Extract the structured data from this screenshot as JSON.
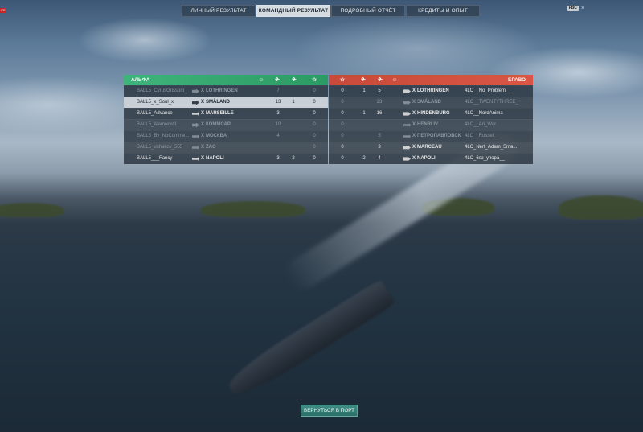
{
  "nav": {
    "tabs": [
      {
        "label": "ЛИЧНЫЙ РЕЗУЛЬТАТ",
        "active": false
      },
      {
        "label": "КОМАНДНЫЙ РЕЗУЛЬТАТ",
        "active": true
      },
      {
        "label": "ПОДРОБНЫЙ ОТЧЁТ",
        "active": false
      },
      {
        "label": "КРЕДИТЫ И ОПЫТ",
        "active": false
      }
    ],
    "fps_badge": "FBC",
    "close_glyph": "×",
    "corner_badge": "PE"
  },
  "team_alpha": {
    "name": "АЛЬФА",
    "color": "#3fb47a",
    "header_icons": [
      "skull-icon",
      "planes-icon",
      "plane-icon",
      "star-icon"
    ],
    "players": [
      {
        "name": "BALL5_CyrusGrissom_",
        "tier": "X",
        "ship": "LOTHRINGEN",
        "class": "dd",
        "kills": "7",
        "planes": "",
        "a": "",
        "score": "0",
        "state": "dead"
      },
      {
        "name": "BALL5_x_Soul_x",
        "tier": "X",
        "ship": "SMÅLAND",
        "class": "dd",
        "kills": "13",
        "planes": "1",
        "a": "",
        "score": "0",
        "state": "self"
      },
      {
        "name": "BALL5_Advance",
        "tier": "X",
        "ship": "MARSEILLE",
        "class": "cv",
        "kills": "3",
        "planes": "",
        "a": "",
        "score": "0",
        "state": "alive"
      },
      {
        "name": "BALL5_Alamreyd1",
        "tier": "X",
        "ship": "КОММСАР",
        "class": "dd",
        "kills": "10",
        "planes": "",
        "a": "",
        "score": "0",
        "state": "dead"
      },
      {
        "name": "BALL5_By_NoComme...",
        "tier": "X",
        "ship": "МОСКВА",
        "class": "cv",
        "kills": "4",
        "planes": "",
        "a": "",
        "score": "0",
        "state": "dead"
      },
      {
        "name": "BALL5_ushakov_555",
        "tier": "X",
        "ship": "ZAO",
        "class": "cv",
        "kills": "",
        "planes": "",
        "a": "",
        "score": "0",
        "state": "dead"
      },
      {
        "name": "BALL5___Fancy",
        "tier": "X",
        "ship": "NAPOLI",
        "class": "cv",
        "kills": "3",
        "planes": "2",
        "a": "",
        "score": "0",
        "state": "alive"
      }
    ]
  },
  "team_bravo": {
    "name": "БРАВО",
    "color": "#d95645",
    "header_icons": [
      "star-icon",
      "plane-icon",
      "planes-icon",
      "skull-icon"
    ],
    "players": [
      {
        "name": "4LC__No_Problem___",
        "tier": "X",
        "ship": "LOTHRINGEN",
        "class": "bb",
        "score": "0",
        "a": "1",
        "planes": "5",
        "kills": "",
        "state": "alive"
      },
      {
        "name": "4LC__TWENTYTHREE_",
        "tier": "X",
        "ship": "SMÅLAND",
        "class": "dd",
        "score": "0",
        "a": "",
        "planes": "23",
        "kills": "",
        "state": "dead"
      },
      {
        "name": "4LC__NordAnima",
        "tier": "X",
        "ship": "HINDENBURG",
        "class": "bb",
        "score": "0",
        "a": "1",
        "planes": "16",
        "kills": "",
        "state": "alive"
      },
      {
        "name": "4LC__Ari_War",
        "tier": "X",
        "ship": "HENRI IV",
        "class": "cv",
        "score": "0",
        "a": "",
        "planes": "",
        "kills": "",
        "state": "dead"
      },
      {
        "name": "4LC__Russell_",
        "tier": "X",
        "ship": "ПЕТРОПАВЛОВСК",
        "class": "cv",
        "score": "0",
        "a": "",
        "planes": "5",
        "kills": "",
        "state": "dead"
      },
      {
        "name": "4LC_Nerf_Adam_Sma...",
        "tier": "X",
        "ship": "MARCEAU",
        "class": "dd",
        "score": "0",
        "a": "",
        "planes": "3",
        "kills": "",
        "state": "alive"
      },
      {
        "name": "4LC_6ез_упора__",
        "tier": "X",
        "ship": "NAPOLI",
        "class": "bb",
        "score": "0",
        "a": "2",
        "planes": "4",
        "kills": "",
        "state": "alive"
      }
    ]
  },
  "footer": {
    "back_button": "ВЕРНУТЬСЯ В ПОРТ"
  }
}
